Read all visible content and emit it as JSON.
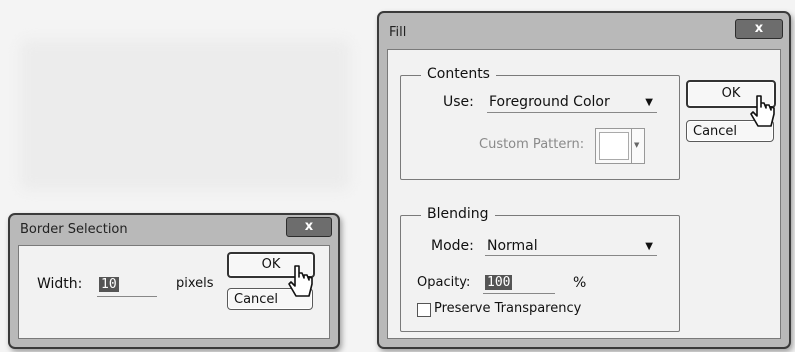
{
  "border_dialog": {
    "title": "Border Selection",
    "close_label": "x",
    "width_label": "Width:",
    "width_value": "10",
    "unit_label": "pixels",
    "ok_label": "OK",
    "cancel_label": "Cancel"
  },
  "fill_dialog": {
    "title": "Fill",
    "close_label": "x",
    "contents": {
      "group_label": "Contents",
      "use_label": "Use:",
      "use_value": "Foreground Color",
      "custom_pattern_label": "Custom Pattern:"
    },
    "blending": {
      "group_label": "Blending",
      "mode_label": "Mode:",
      "mode_value": "Normal",
      "opacity_label": "Opacity:",
      "opacity_value": "100",
      "opacity_unit": "%",
      "preserve_label": "Preserve Transparency",
      "preserve_checked": false
    },
    "ok_label": "OK",
    "cancel_label": "Cancel"
  }
}
